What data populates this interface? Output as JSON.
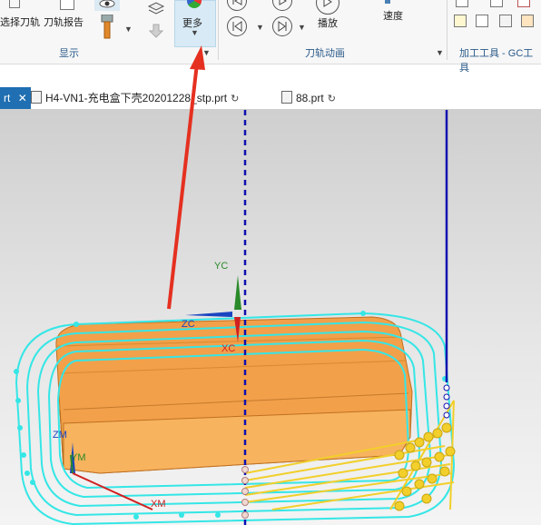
{
  "ribbon": {
    "select_toolpath": "选择刀轨",
    "toolpath_report": "刀轨报告",
    "more": "更多",
    "play": "播放",
    "speed": "速度",
    "group_display": "显示",
    "group_animation": "刀轨动画",
    "group_tools": "加工工具 - GC工具"
  },
  "tabs": [
    {
      "label": "rt",
      "close": "✕"
    },
    {
      "label": "H4-VN1-充电盒下壳202012​28_stp.prt"
    },
    {
      "label": "88.prt"
    }
  ],
  "viewport": {
    "axes": {
      "yc": "YC",
      "zc": "ZC",
      "xc": "XC",
      "zm": "ZM",
      "ym": "YM",
      "xm": "XM"
    }
  },
  "colors": {
    "ribbon_bg": "#f7f7f7",
    "active_tab": "#1f6fb2",
    "part": "#f5a54a",
    "toolpath": "#35e6e6",
    "tool_line": "#1010b0",
    "arrow": "#e53020",
    "engage": "#f2cf2a"
  }
}
